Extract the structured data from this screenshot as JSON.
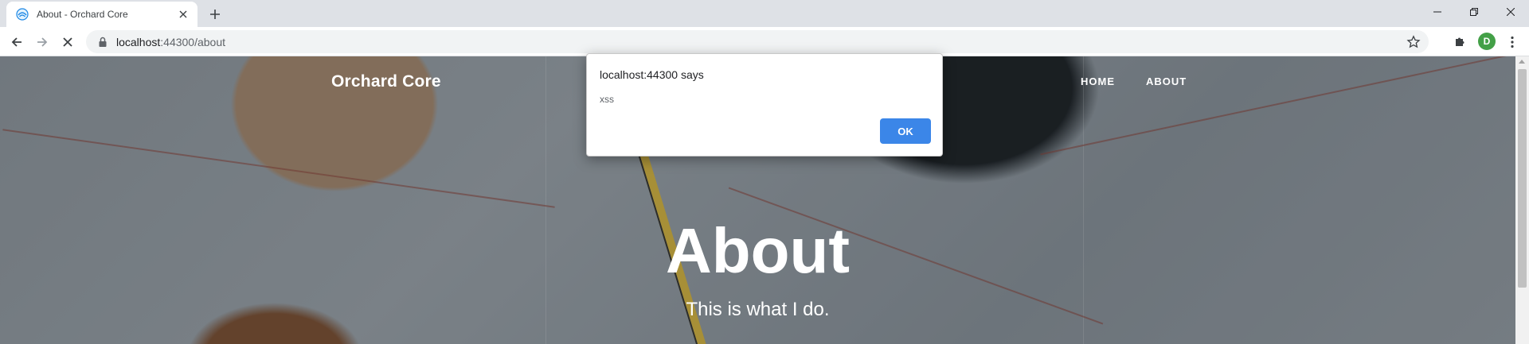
{
  "browser": {
    "tab": {
      "title": "About - Orchard Core",
      "favicon": "orchard-favicon",
      "close_icon": "close-icon"
    },
    "new_tab_icon": "plus-icon",
    "window_controls": [
      "minimize-icon",
      "restore-icon",
      "close-icon"
    ],
    "toolbar": {
      "back_icon": "arrow-left-icon",
      "forward_icon": "arrow-right-icon",
      "stop_icon": "stop-icon",
      "lock_icon": "lock-icon",
      "url_host": "localhost",
      "url_rest": ":44300/about",
      "bookmark_icon": "star-icon",
      "extensions_icon": "puzzle-icon",
      "avatar_letter": "D",
      "menu_icon": "kebab-menu-icon"
    }
  },
  "site": {
    "brand": "Orchard Core",
    "nav": [
      {
        "label": "HOME"
      },
      {
        "label": "ABOUT"
      }
    ],
    "hero": {
      "title": "About",
      "subtitle": "This is what I do."
    }
  },
  "dialog": {
    "title": "localhost:44300 says",
    "message": "xss",
    "ok_label": "OK",
    "ok_color": "#3b86e8"
  },
  "colors": {
    "avatar": "#43a047",
    "tabstrip": "#dee1e6",
    "omnibox": "#f1f3f4"
  }
}
